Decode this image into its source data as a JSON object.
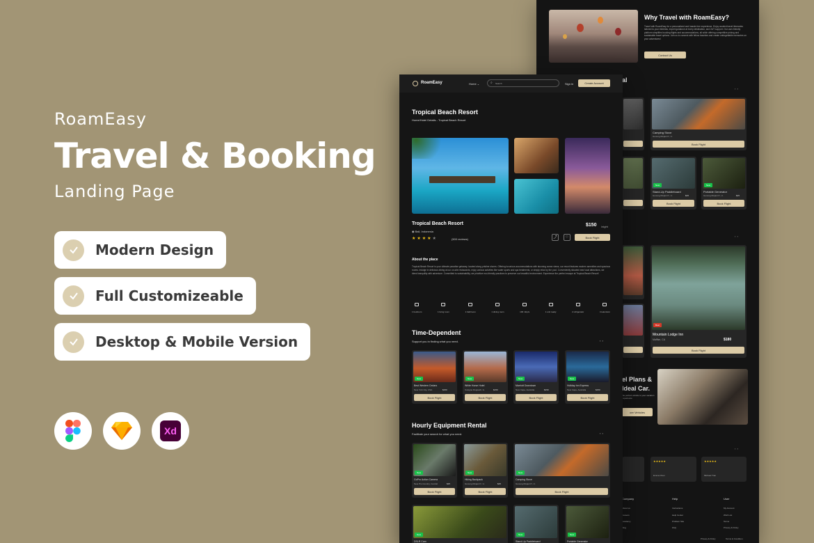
{
  "hero": {
    "brand": "RoamEasy",
    "title": "Travel & Booking",
    "subtitle": "Landing Page",
    "features": [
      "Modern Design",
      "Full Customizeable",
      "Desktop & Mobile Version"
    ],
    "tools": [
      "figma-icon",
      "sketch-icon",
      "xd-icon"
    ],
    "xd_label": "Xd"
  },
  "colors": {
    "background": "#a29575",
    "screen": "#141414",
    "accent": "#dccba6",
    "tag": "#19c24a",
    "star": "#f5c518"
  },
  "nav": {
    "logo": "RoamEasy",
    "home": "Home ⌄",
    "search_placeholder": "Search",
    "signin": "Sign in",
    "create": "Create Account"
  },
  "resort": {
    "title": "Tropical Beach Resort",
    "breadcrumb": "Home/Hotel Details - Tropical Beach Resort",
    "name": "Tropical Beach Resort",
    "location": "Bali, Indonesia",
    "reviews": "(500 reviews)",
    "price": "$150",
    "per": "/night",
    "book": "Book Flight",
    "about_title": "About the place",
    "about_text": "Tropical Beach Resort is your ultimate paradise getaway, located along pristine shores. Offering luxurious accommodations with stunning ocean views, our resort features modern amenities and spacious rooms. Indulge in delicious dining at our on-site restaurants, enjoy various activities like water sports and spa treatments, or simply relax by the pool. Conveniently situated near local attractions, we blend tranquility with adventure. Committed to sustainability, we prioritize eco-friendly practices to preserve our beautiful environment. Experience the perfect escape at Tropical Beach Resort!"
  },
  "amenities": [
    "1 bedroom",
    "1 living room",
    "1 bathroom",
    "1 dining room",
    "100 mbp/s",
    "1 unit ready",
    "2 refrigerator",
    "4 television"
  ],
  "time_dependent": {
    "title": "Time-Dependent",
    "subtitle": "Support you in finding what you need.",
    "cards": [
      {
        "name": "Best Western Cedars",
        "loc": "New York City, USA",
        "price": "$150"
      },
      {
        "name": "White Horse Hotel",
        "loc": "Cologne Ruppach, G.",
        "price": "$150"
      },
      {
        "name": "Marriott Downtown",
        "loc": "New Cape, Australia",
        "price": "$150"
      },
      {
        "name": "Holiday Inn Express",
        "loc": "New Cape, Australia",
        "price": "$150"
      }
    ]
  },
  "equipment": {
    "title": "Hourly Equipment Rental",
    "subtitle": "Facilitate your search for what you need.",
    "cards": [
      {
        "name": "GoPro Action Camera",
        "loc": "New Pro Country, Central",
        "price": "$25"
      },
      {
        "name": "Hiking Backpack",
        "loc": "Gunung Rinjani P., U.",
        "price": "$25"
      },
      {
        "name": "Camping Stove",
        "loc": "Gunung Rinjani P., U."
      }
    ],
    "row2": [
      "DSLR Cam",
      "Stand-Up Paddleboard",
      "Portable Generator"
    ]
  },
  "back": {
    "why_title": "Why Travel with RoamEasy?",
    "why_text": "Travel with RoamEasy for a personalized and hassle-free experience. Enjoy curated travel itineraries tailored to your interests, expert guidance at every destination, and 24/7 support. Our user-friendly platform simplifies booking flights and accommodations, all while offering competitive pricing and sustainable travel options. Join us to connect with fellow travelers and create unforgettable memories on your adventures!",
    "contact": "Contact Us",
    "frag_al": "al",
    "camping": "Camping Stove",
    "camping_loc": "Gunung Rinjani P., U.",
    "paddle": "Stand-Up Paddleboard",
    "paddle_loc": "Gunung Rinjani P., U.",
    "paddle_price": "$25",
    "generator": "Portable Generator",
    "generator_loc": "Gunung Rinjani P., U.",
    "generator_price": "$25",
    "lodge": "Mountain Lodge Inn",
    "lodge_loc": "Mafflse, CA",
    "lodge_price": "$180",
    "plans1": "el Plans &",
    "plans2": "Ideal Car.",
    "plans_text": "the perfect vehicle to your vacation experience",
    "rent": "ore Vehicles",
    "reviewers": [
      "Emma Chen",
      "Michael Tran"
    ],
    "footer_cols": [
      "Company",
      "Help",
      "User"
    ],
    "help_links": [
      "Instructions",
      "Help Center",
      "Problem Site",
      "FAQ"
    ],
    "user_links": [
      "My Account",
      "Wish List",
      "Terms",
      "Privacy & Policy"
    ],
    "company_links": [
      "About us",
      "Careers",
      "Academy",
      "Blog"
    ],
    "bottom_links": [
      "Privacy & Policy",
      "Terms & Condition"
    ]
  }
}
